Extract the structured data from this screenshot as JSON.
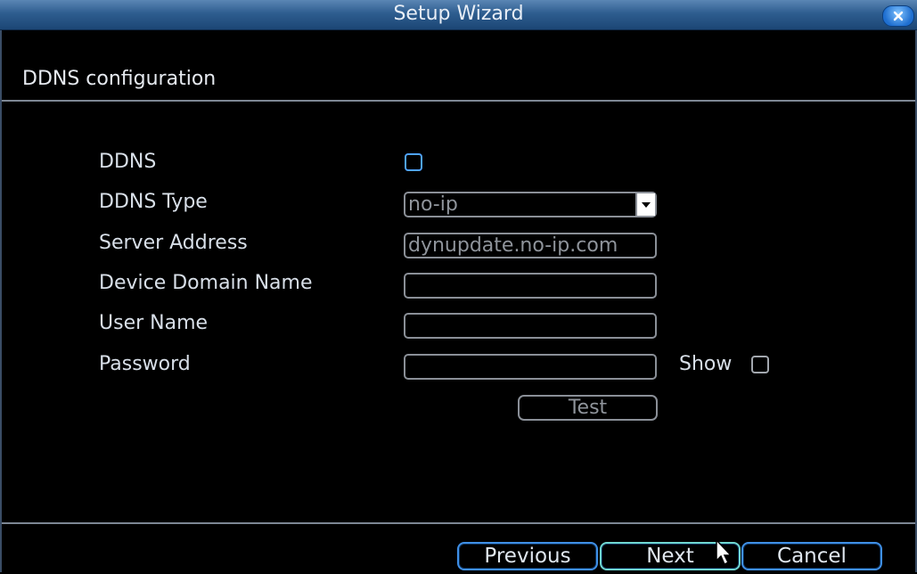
{
  "window": {
    "title": "Setup Wizard"
  },
  "section": {
    "title": "DDNS configuration"
  },
  "form": {
    "ddns_label": "DDNS",
    "ddns_enabled": false,
    "ddns_type_label": "DDNS Type",
    "ddns_type_value": "no-ip",
    "server_address_label": "Server Address",
    "server_address_value": "dynupdate.no-ip.com",
    "device_domain_label": "Device Domain Name",
    "device_domain_value": "",
    "user_name_label": "User Name",
    "user_name_value": "",
    "password_label": "Password",
    "password_value": "",
    "show_label": "Show",
    "show_checked": false,
    "test_label": "Test"
  },
  "footer": {
    "previous_label": "Previous",
    "next_label": "Next",
    "cancel_label": "Cancel"
  },
  "colors": {
    "titlebar": "#2e5d8f",
    "accent_border": "#3f8fe6",
    "active_border": "#6fd6d0",
    "field_border": "#8a8f97",
    "background": "#000000"
  },
  "icons": {
    "close": "close-icon",
    "dropdown": "chevron-down-icon",
    "cursor": "mouse-pointer-icon"
  }
}
